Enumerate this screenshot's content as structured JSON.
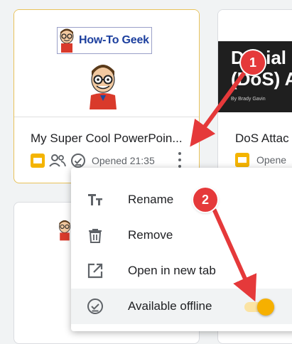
{
  "card1": {
    "logo_text": "How-To Geek",
    "title": "My Super Cool PowerPoin...",
    "opened": "Opened 21:35",
    "icons": [
      "slides-icon",
      "shared-icon",
      "offline-icon",
      "more-options-icon"
    ]
  },
  "card2": {
    "thumb_line1": "Denial",
    "thumb_line2": "(DoS) A",
    "thumb_sub": "By Brady Gavin",
    "title": "DoS Attac",
    "opened": "Opene"
  },
  "menu": {
    "items": [
      {
        "label": "Rename",
        "icon": "text-format-icon"
      },
      {
        "label": "Remove",
        "icon": "trash-icon"
      },
      {
        "label": "Open in new tab",
        "icon": "open-in-new-icon"
      },
      {
        "label": "Available offline",
        "icon": "offline-check-icon",
        "toggle_on": true
      }
    ]
  },
  "annotations": {
    "step1": "1",
    "step2": "2"
  },
  "colors": {
    "accent_yellow": "#f4b400",
    "annotation_red": "#e5393a",
    "selected_card_border": "#e8c25a"
  }
}
